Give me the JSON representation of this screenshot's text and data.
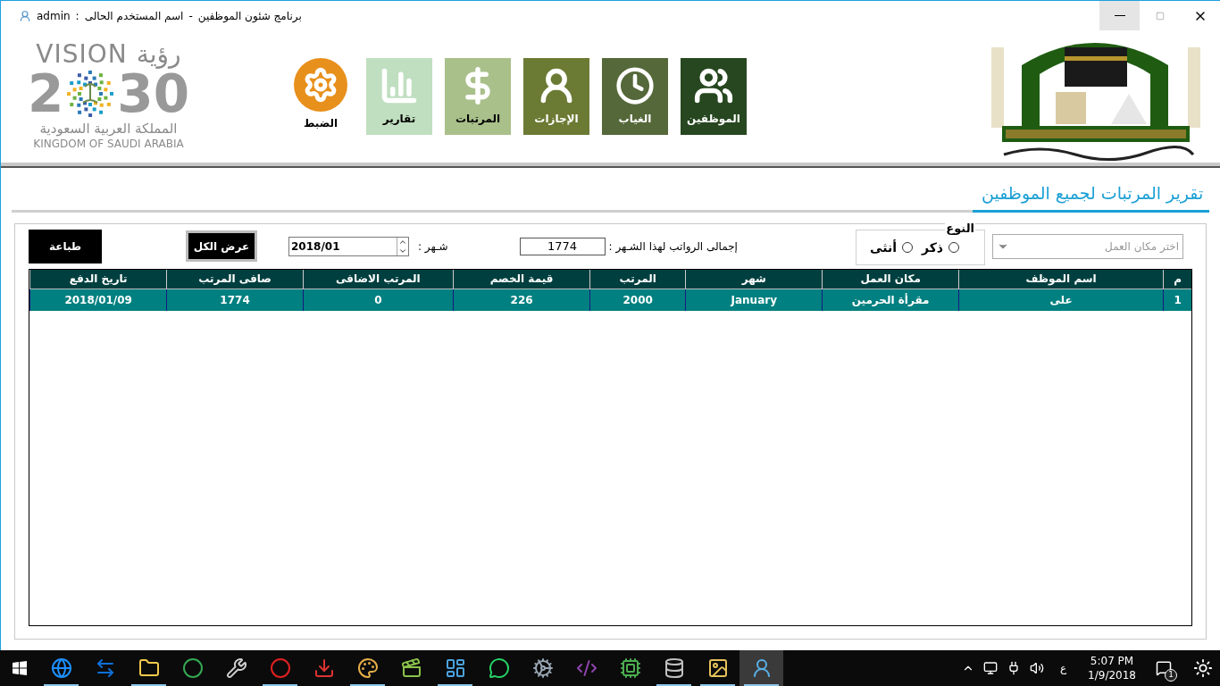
{
  "title_bar": {
    "parts": [
      "برنامج شئون الموظفين",
      "-",
      "اسم المستخدم الحالى",
      ":",
      "admin"
    ]
  },
  "vision_logo": {
    "top_latin": "VISION",
    "top_arabic": "رؤية",
    "year_start": "2",
    "year_end": "30",
    "country_arabic": "المملكة العربية السعودية",
    "country_latin": "KINGDOM OF SAUDI ARABIA"
  },
  "nav": [
    {
      "label": "الموظفين",
      "kind": "tile",
      "color": "#26471f"
    },
    {
      "label": "الغياب",
      "kind": "tile",
      "color": "#55683a"
    },
    {
      "label": "الإجازات",
      "kind": "tile",
      "color": "#6b7b34"
    },
    {
      "label": "المرتبات",
      "kind": "tile",
      "color": "#a9c08a"
    },
    {
      "label": "تقارير",
      "kind": "tile",
      "color": "#c0dfc0"
    },
    {
      "label": "الضبط",
      "kind": "circle",
      "color": "#e8901c"
    }
  ],
  "page_title": "تقرير المرتبات لجميع الموظفين",
  "filters": {
    "print_button": "طباعة",
    "show_all_button": "عرض الكل",
    "month_value": "2018/01",
    "month_label": "شـهر :",
    "total_value": "1774",
    "total_label": "إجمالى الرواتب لهذا الشـهر :",
    "gender": {
      "legend": "النوع",
      "options": [
        {
          "label": "ذكر",
          "selected": false
        },
        {
          "label": "أنثى",
          "selected": false
        }
      ]
    },
    "workplace": {
      "placeholder": "اختر مكان العمل"
    }
  },
  "table": {
    "columns": [
      "م",
      "اسم الموظف",
      "مكان العمل",
      "شهر",
      "المرتب",
      "قيمة الخصم",
      "المرتب الاضافى",
      "صافى المرتب",
      "تاريخ الدفع"
    ],
    "rows": [
      {
        "cells": [
          "1",
          "على",
          "مقرأة الحرمين",
          "January",
          "2000",
          "226",
          "0",
          "1774",
          "2018/01/09"
        ],
        "selected": true
      }
    ]
  },
  "taskbar": {
    "apps": [
      {
        "running": true,
        "active": false
      },
      {
        "running": false,
        "active": false
      },
      {
        "running": true,
        "active": false
      },
      {
        "running": false,
        "active": false
      },
      {
        "running": false,
        "active": false
      },
      {
        "running": true,
        "active": false
      },
      {
        "running": false,
        "active": false
      },
      {
        "running": true,
        "active": false
      },
      {
        "running": false,
        "active": false
      },
      {
        "running": true,
        "active": false
      },
      {
        "running": false,
        "active": false
      },
      {
        "running": false,
        "active": false
      },
      {
        "running": false,
        "active": false
      },
      {
        "running": false,
        "active": false
      },
      {
        "running": true,
        "active": false
      },
      {
        "running": true,
        "active": false
      },
      {
        "running": true,
        "active": true
      }
    ],
    "keyboard": "ع",
    "time": "5:07 PM",
    "date": "1/9/2018",
    "notifications": "1"
  }
}
